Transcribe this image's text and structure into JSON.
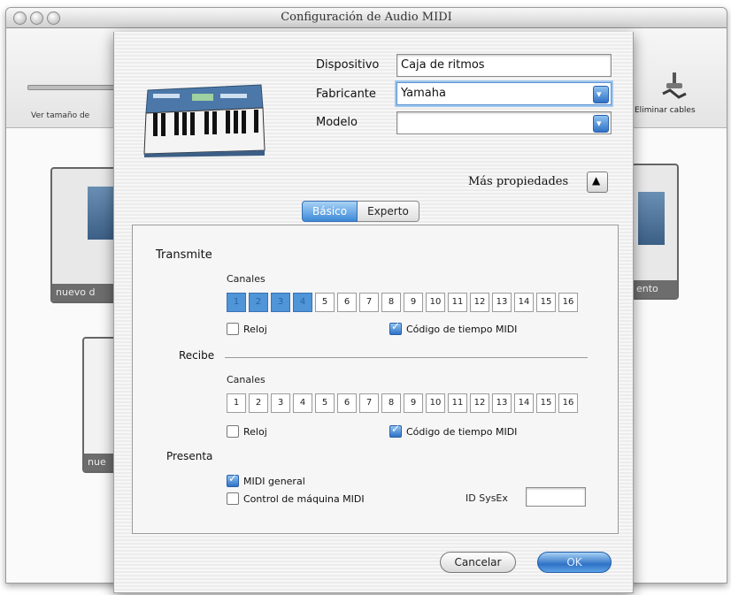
{
  "window": {
    "title": "Configuración de Audio MIDI",
    "toolbar_left_label": "Ver tamaño de",
    "toolbar_right_label": "Eliminar cables",
    "bg_device_label_1": "nuevo d",
    "bg_device_label_2": "nue",
    "bg_device_label_right": "ento"
  },
  "sheet": {
    "device_label": "Dispositivo",
    "device_value": "Caja de ritmos",
    "manufacturer_label": "Fabricante",
    "manufacturer_value": "Yamaha",
    "model_label": "Modelo",
    "model_value": "",
    "more_properties": "Más propiedades",
    "tabs": [
      "Básico",
      "Experto"
    ]
  },
  "panel": {
    "transmit_label": "Transmite",
    "transmit_channels_label": "Canales",
    "transmit_channels": [
      "1",
      "2",
      "3",
      "4",
      "5",
      "6",
      "7",
      "8",
      "9",
      "10",
      "11",
      "12",
      "13",
      "14",
      "15",
      "16"
    ],
    "transmit_selected": [
      1,
      2,
      3,
      4
    ],
    "transmit_clock": "Reloj",
    "transmit_clock_checked": false,
    "transmit_mtc": "Código de tiempo MIDI",
    "transmit_mtc_checked": true,
    "receive_label": "Recibe",
    "receive_channels_label": "Canales",
    "receive_channels": [
      "1",
      "2",
      "3",
      "4",
      "5",
      "6",
      "7",
      "8",
      "9",
      "10",
      "11",
      "12",
      "13",
      "14",
      "15",
      "16"
    ],
    "receive_clock": "Reloj",
    "receive_clock_checked": false,
    "receive_mtc": "Código de tiempo MIDI",
    "receive_mtc_checked": true,
    "presents_label": "Presenta",
    "general_midi": "MIDI general",
    "general_midi_checked": true,
    "mmc": "Control de máquina MIDI",
    "mmc_checked": false,
    "sysex_label": "ID SysEx",
    "sysex_value": ""
  },
  "buttons": {
    "cancel": "Cancelar",
    "ok": "OK"
  },
  "colors": {
    "accent": "#3d89d8",
    "selected_channel": "#4f95d8"
  }
}
